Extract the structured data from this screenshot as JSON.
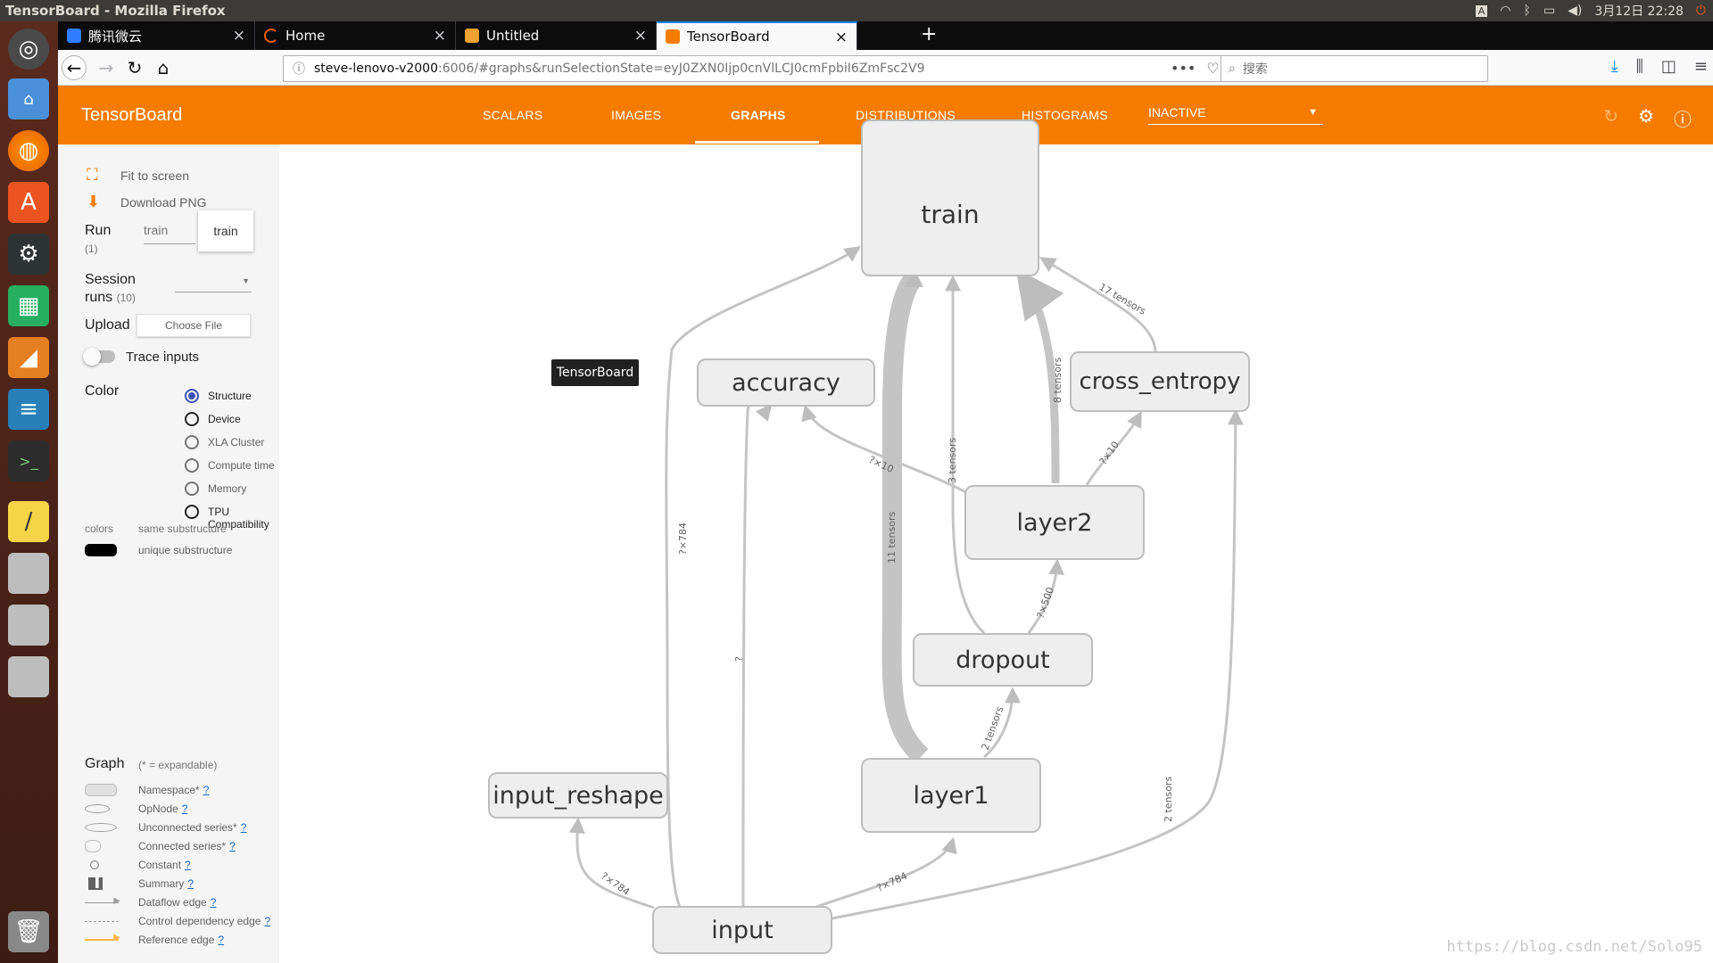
{
  "os": {
    "window_title": "TensorBoard - Mozilla Firefox",
    "clock": "3月12日 22:28",
    "tray_icons": [
      "keyboard-icon",
      "wifi-icon",
      "bluetooth-icon",
      "battery-icon",
      "volume-icon",
      "power-icon"
    ]
  },
  "launcher": {
    "items": [
      "ubuntu-dash-icon",
      "files-icon",
      "firefox-icon",
      "software-center-icon",
      "settings-icon",
      "calc-icon",
      "impress-icon",
      "writer-icon",
      "terminal-icon",
      "notes-icon",
      "drive-icon",
      "drive-icon",
      "drive-icon",
      "trash-icon"
    ]
  },
  "browser": {
    "tabs": [
      {
        "label": "腾讯微云",
        "icon": "weiyun-icon",
        "active": false
      },
      {
        "label": "Home",
        "icon": "loading-icon",
        "active": false
      },
      {
        "label": "Untitled",
        "icon": "notebook-icon",
        "active": false
      },
      {
        "label": "TensorBoard",
        "icon": "tensorboard-icon",
        "active": true
      }
    ],
    "new_tab": "+",
    "url_host": "steve-lenovo-v2000",
    "url_rest": ":6006/#graphs&runSelectionState=eyJ0ZXN0Ijp0cnVlLCJ0cmFpbiI6ZmFsc2V9",
    "search_placeholder": "搜索"
  },
  "tensorboard": {
    "title": "TensorBoard",
    "tabs": [
      "SCALARS",
      "IMAGES",
      "GRAPHS",
      "DISTRIBUTIONS",
      "HISTOGRAMS"
    ],
    "active_tab": "GRAPHS",
    "inactive_label": "INACTIVE",
    "accent": "#f57c00"
  },
  "sidebar": {
    "fit_to_screen": "Fit to screen",
    "download_png": "Download PNG",
    "run_label": "Run",
    "run_count": "(1)",
    "run_value": "train",
    "run_dropdown_option": "train",
    "session_label_1": "Session",
    "session_label_2": "runs",
    "session_count": "(10)",
    "upload_label": "Upload",
    "choose_file": "Choose File",
    "trace_inputs": "Trace inputs",
    "color_label": "Color",
    "color_options": [
      {
        "label": "Structure",
        "checked": true,
        "dim": false
      },
      {
        "label": "Device",
        "checked": false,
        "dim": false
      },
      {
        "label": "XLA Cluster",
        "checked": false,
        "dim": true
      },
      {
        "label": "Compute time",
        "checked": false,
        "dim": true
      },
      {
        "label": "Memory",
        "checked": false,
        "dim": true
      },
      {
        "label": "TPU Compatibility",
        "checked": false,
        "dim": false
      }
    ],
    "colors_label": "colors",
    "same_substructure": "same substructure",
    "unique_substructure": "unique substructure",
    "graph_label": "Graph",
    "expandable_note": "(* = expandable)",
    "legend": [
      {
        "label": "Namespace*",
        "help": "?"
      },
      {
        "label": "OpNode",
        "help": "?"
      },
      {
        "label": "Unconnected series*",
        "help": "?"
      },
      {
        "label": "Connected series*",
        "help": "?"
      },
      {
        "label": "Constant",
        "help": "?"
      },
      {
        "label": "Summary",
        "help": "?"
      },
      {
        "label": "Dataflow edge",
        "help": "?"
      },
      {
        "label": "Control dependency edge",
        "help": "?"
      },
      {
        "label": "Reference edge",
        "help": "?"
      }
    ]
  },
  "graph": {
    "nodes": {
      "train": "train",
      "accuracy": "accuracy",
      "cross_entropy": "cross_entropy",
      "layer2": "layer2",
      "dropout": "dropout",
      "layer1": "layer1",
      "input_reshape": "input_reshape",
      "input": "input"
    },
    "edge_labels": {
      "input_train": "?×784",
      "input_accuracy": "?",
      "input_reshape": "?×784",
      "input_layer1": "?×784",
      "input_cross_entropy": "2 tensors",
      "layer1_train": "11 tensors",
      "layer1_dropout": "2 tensors",
      "dropout_layer2": "?×500",
      "dropout_train": "3 tensors",
      "layer2_train": "8 tensors",
      "layer2_accuracy": "?×10",
      "layer2_cross_entropy": "?×10",
      "cross_entropy_train": "17 tensors"
    },
    "tooltip": "TensorBoard"
  },
  "watermark": "https://blog.csdn.net/Solo95"
}
